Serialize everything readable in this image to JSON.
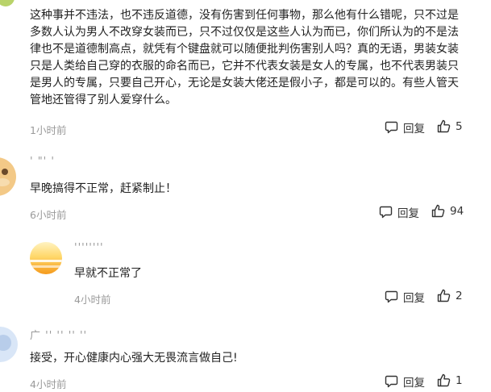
{
  "comments": [
    {
      "text_lines": [
        "这种事并不违法，也不违反道德，没有伤害到任何事物，那么他有什么错呢，只不过是",
        "多数人认为男人不改穿女装而已，只不过仅仅是这些人认为而已，你们所认为的不是法",
        "律也不是道德制高点，就凭有个键盘就可以随便批判伤害别人吗？真的无语，男装女装",
        "只是人类给自己穿的衣服的命名而已，它并不代表女装是女人的专属，也不代表男装只",
        "是男人的专属，只要自己开心，无论是女装大佬还是假小子，都是可以的。有些人管天",
        "管地还管得了别人爱穿什么。"
      ],
      "time": "1小时前",
      "reply_label": "回复",
      "likes": "5"
    },
    {
      "username": "' \"' '",
      "text": "早晚搞得不正常，赶紧制止！",
      "time": "6小时前",
      "reply_label": "回复",
      "likes": "94"
    },
    {
      "username": "''''''''",
      "text": "早就不正常了",
      "time": "4小时前",
      "reply_label": "回复",
      "likes": "2"
    },
    {
      "username": "广 '' '' '' ''",
      "text": "接受，开心健康内心强大无畏流言做自己!",
      "time": "4小时前",
      "reply_label": "回复",
      "likes": "1"
    }
  ],
  "icons": {
    "reply": "speech-bubble-icon",
    "like": "thumbs-up-icon"
  },
  "colors": {
    "text": "#222222",
    "meta": "#9a9a9a",
    "icon": "#333333"
  }
}
